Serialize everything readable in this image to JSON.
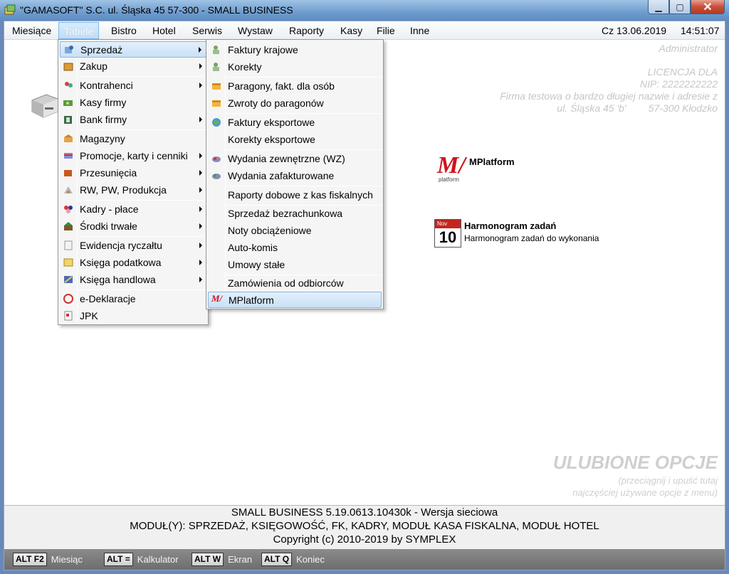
{
  "window": {
    "title": "\"GAMASOFT\" S.C. ul. Śląska 45 57-300 - SMALL BUSINESS",
    "minimize_glyph": "▁",
    "maximize_glyph": "▢",
    "close_glyph": "✕"
  },
  "menubar": {
    "items": [
      "Miesiące",
      "Tabele",
      "Bistro",
      "Hotel",
      "Serwis",
      "Wystaw",
      "Raporty",
      "Kasy",
      "Filie",
      "Inne"
    ],
    "date": "Cz 13.06.2019",
    "time": "14:51:07"
  },
  "tabele_menu": {
    "items": [
      {
        "label": "Sprzedaż",
        "icon": "sales-icon",
        "submenu": true
      },
      {
        "label": "Zakup",
        "icon": "purchase-box-icon",
        "submenu": true
      },
      {
        "label": "Kontrahenci",
        "icon": "contractors-icon",
        "submenu": true
      },
      {
        "label": "Kasy firmy",
        "icon": "cash-icon",
        "submenu": false
      },
      {
        "label": "Bank firmy",
        "icon": "bank-icon",
        "submenu": true
      },
      {
        "label": "Magazyny",
        "icon": "warehouse-icon",
        "submenu": false
      },
      {
        "label": "Promocje, karty i cenniki",
        "icon": "promotions-icon",
        "submenu": true
      },
      {
        "label": "Przesunięcia",
        "icon": "transfer-icon",
        "submenu": true
      },
      {
        "label": "RW, PW, Produkcja",
        "icon": "production-icon",
        "submenu": true
      },
      {
        "label": "Kadry - płace",
        "icon": "hr-icon",
        "submenu": true
      },
      {
        "label": "Środki trwałe",
        "icon": "fixed-assets-icon",
        "submenu": true
      },
      {
        "label": "Ewidencja ryczałtu",
        "icon": "lump-sum-icon",
        "submenu": true
      },
      {
        "label": "Księga podatkowa",
        "icon": "tax-book-icon",
        "submenu": true
      },
      {
        "label": "Księga handlowa",
        "icon": "trade-book-icon",
        "submenu": true
      },
      {
        "label": "e-Deklaracje",
        "icon": "e-declaration-icon",
        "submenu": false
      },
      {
        "label": "JPK",
        "icon": "jpk-icon",
        "submenu": false
      }
    ]
  },
  "sprzedaz_menu": {
    "items": [
      {
        "label": "Faktury krajowe",
        "icon": "invoice-icon"
      },
      {
        "label": "Korekty",
        "icon": "correction-icon"
      },
      {
        "label": "Paragony, fakt. dla osób",
        "icon": "receipt-icon"
      },
      {
        "label": "Zwroty do paragonów",
        "icon": "receipt-return-icon"
      },
      {
        "label": "Faktury eksportowe",
        "icon": "export-invoice-icon"
      },
      {
        "label": "Korekty eksportowe",
        "icon": ""
      },
      {
        "label": "Wydania zewnętrzne (WZ)",
        "icon": "external-release-icon"
      },
      {
        "label": "Wydania zafakturowane",
        "icon": "invoiced-release-icon"
      },
      {
        "label": "Raporty dobowe z kas fiskalnych",
        "icon": ""
      },
      {
        "label": "Sprzedaż bezrachunkowa",
        "icon": ""
      },
      {
        "label": "Noty obciążeniowe",
        "icon": ""
      },
      {
        "label": "Auto-komis",
        "icon": ""
      },
      {
        "label": "Umowy stałe",
        "icon": ""
      },
      {
        "label": "Zamówienia od odbiorców",
        "icon": ""
      },
      {
        "label": "MPlatform",
        "icon": "mplatform-icon"
      }
    ]
  },
  "info": {
    "user": "Administrator",
    "license": "LICENCJA DLA",
    "nip": "NIP: 2222222222",
    "company": "Firma testowa o bardzo długiej nazwie i adresie z",
    "address": "ul. Śląska 45 'b'        57-300 Kłodzko"
  },
  "shortcuts": {
    "mplatform": {
      "title": "MPlatform",
      "logo_text": "M/",
      "logo_sub": "platform"
    },
    "harmonogram": {
      "title": "Harmonogram zadań",
      "desc": "Harmonogram zadań do wykonania",
      "cal_month": "Nov",
      "cal_day": "10"
    }
  },
  "favorites": {
    "title": "ULUBIONE OPCJE",
    "line1": "(przeciągnij i upuść tutaj",
    "line2": "najczęściej używane opcje z menu)"
  },
  "status": {
    "line1": "SMALL BUSINESS 5.19.0613.10430k  - Wersja sieciowa",
    "line2": "MODUŁ(Y): SPRZEDAŻ, KSIĘGOWOŚĆ, FK, KADRY, MODUŁ KASA FISKALNA, MODUŁ HOTEL",
    "line3": "Copyright (c) 2010-2019 by SYMPLEX"
  },
  "fkeys": [
    {
      "key": "ALT F2",
      "label": "Miesiąc"
    },
    {
      "key": "ALT =",
      "label": "Kalkulator"
    },
    {
      "key": "ALT W",
      "label": "Ekran"
    },
    {
      "key": "ALT Q",
      "label": "Koniec"
    }
  ]
}
